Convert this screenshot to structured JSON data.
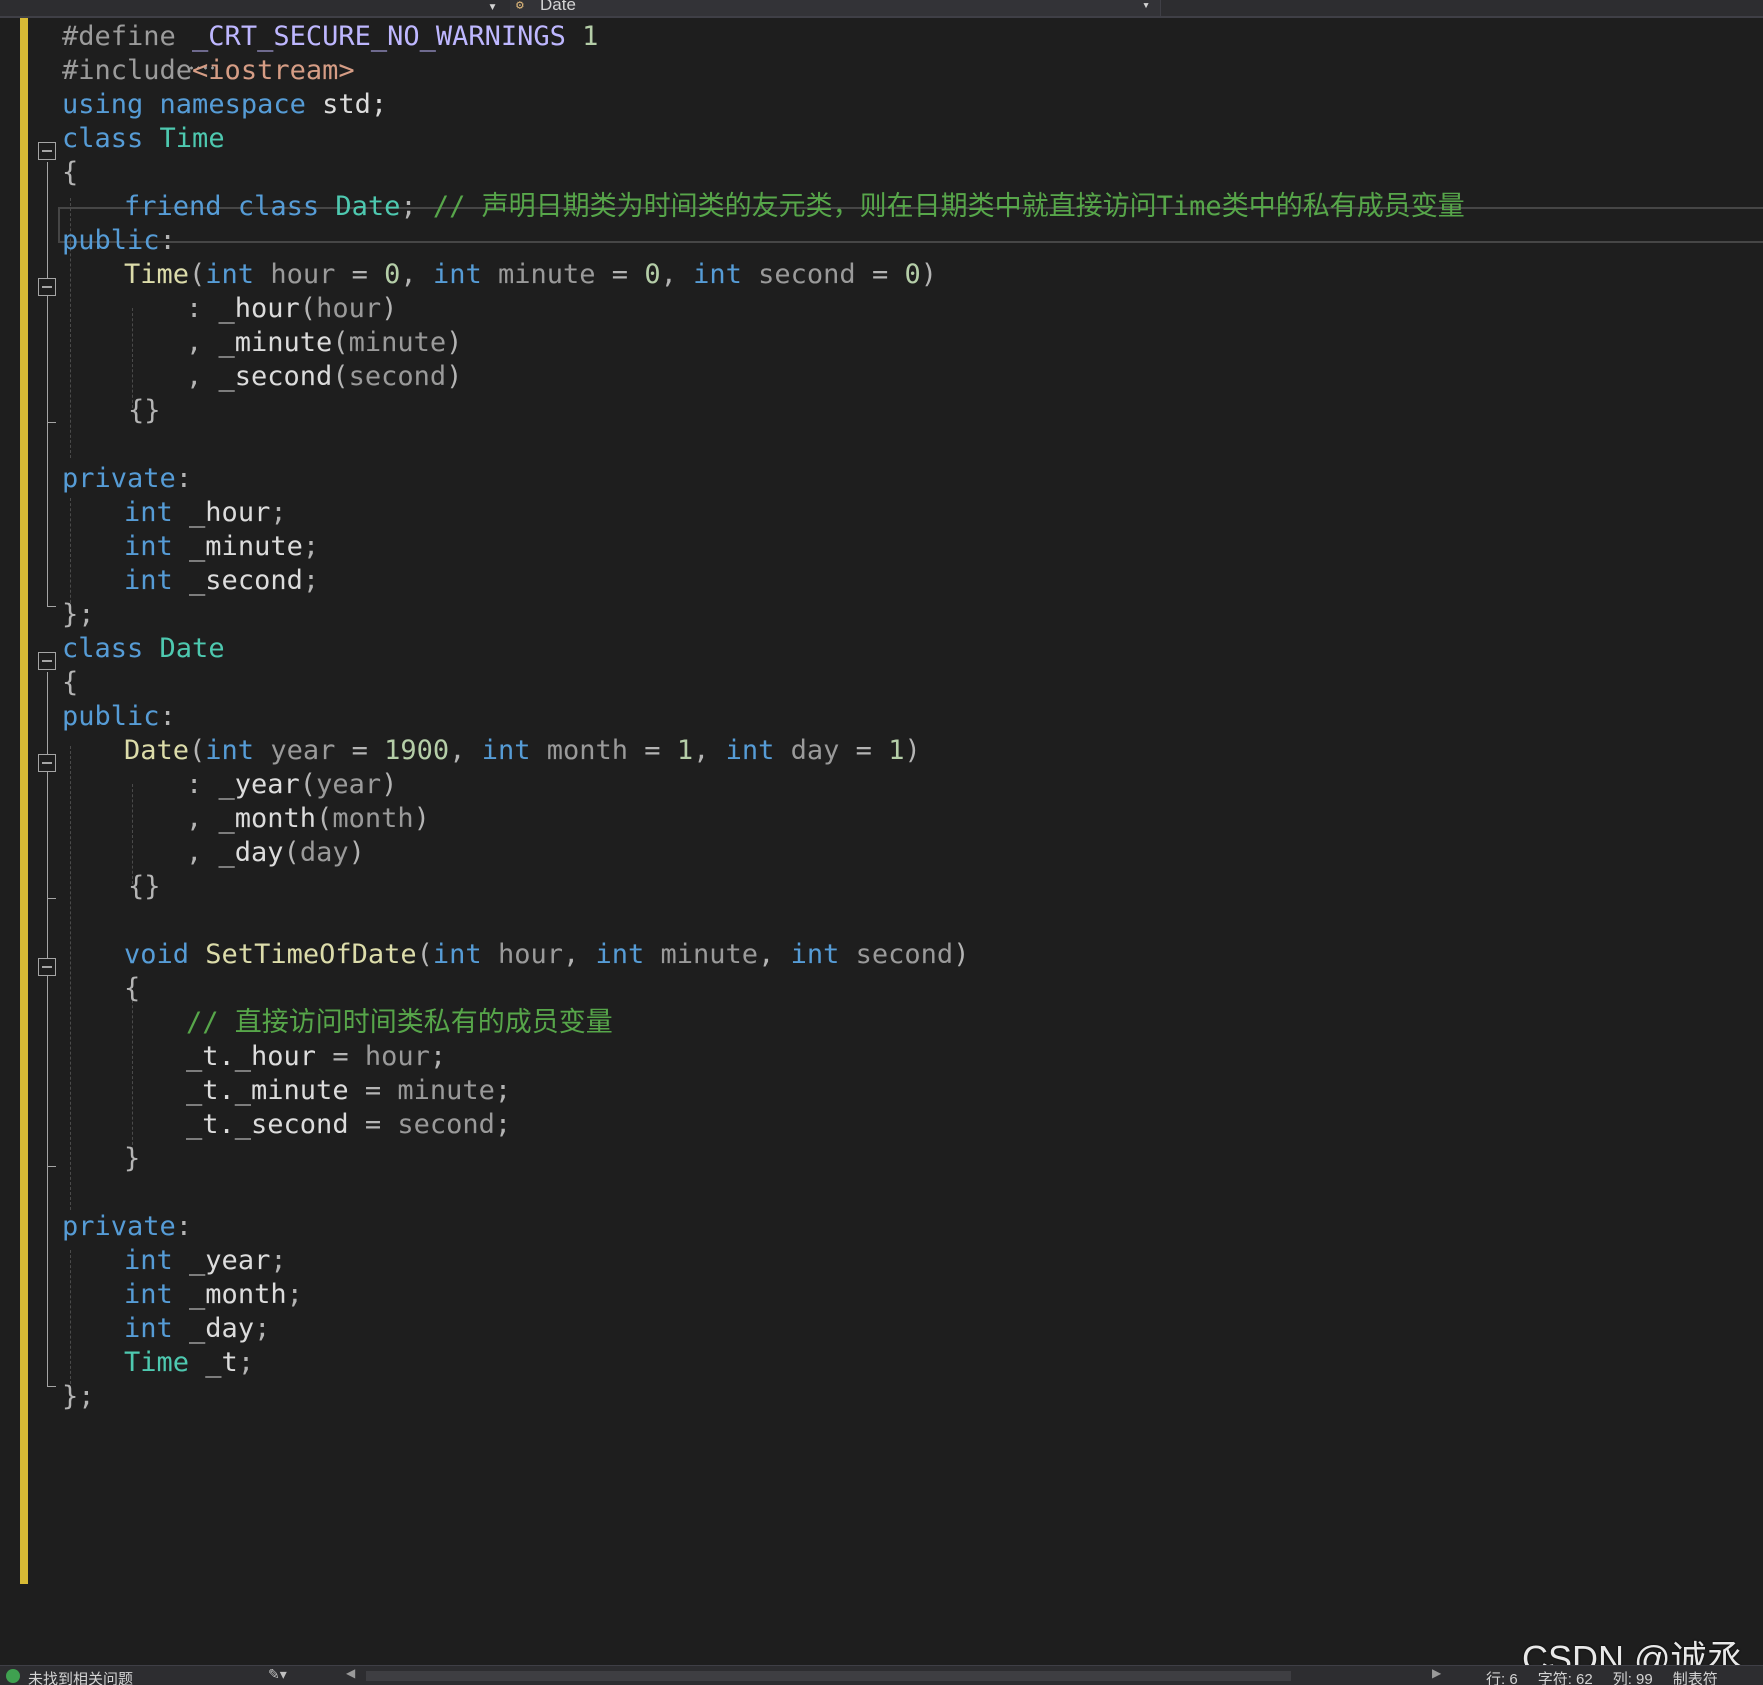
{
  "navbar": {
    "left_dropdown_chevron": "▾",
    "member_icon": "class-icon",
    "member_label": "Date",
    "member_chevron": "▾"
  },
  "code": {
    "l1": [
      "#define ",
      "_CRT_SECURE_NO_WARNINGS",
      " 1"
    ],
    "l2": [
      "#include",
      "<iostream>"
    ],
    "l3": [
      "using",
      " ",
      "namespace",
      " std;"
    ],
    "l4": [
      "class",
      " ",
      "Time"
    ],
    "l5": [
      "{"
    ],
    "l6": [
      "friend",
      " ",
      "class",
      " ",
      "Date",
      "; ",
      "// 声明日期类为时间类的友元类，则在日期类中就直接访问Time类中的私有成员变量"
    ],
    "l7": [
      "public",
      ":"
    ],
    "l8": [
      "Time",
      "(",
      "int",
      " ",
      "hour",
      " = ",
      "0",
      ", ",
      "int",
      " ",
      "minute",
      " = ",
      "0",
      ", ",
      "int",
      " ",
      "second",
      " = ",
      "0",
      ")"
    ],
    "l9": [
      ": ",
      "_hour",
      "(",
      "hour",
      ")"
    ],
    "l10": [
      ", ",
      "_minute",
      "(",
      "minute",
      ")"
    ],
    "l11": [
      ", ",
      "_second",
      "(",
      "second",
      ")"
    ],
    "l12": [
      "{}"
    ],
    "l14": [
      "private",
      ":"
    ],
    "l15": [
      "int",
      " ",
      "_hour",
      ";"
    ],
    "l16": [
      "int",
      " ",
      "_minute",
      ";"
    ],
    "l17": [
      "int",
      " ",
      "_second",
      ";"
    ],
    "l18": [
      "};"
    ],
    "l19": [
      "class",
      " ",
      "Date"
    ],
    "l20": [
      "{"
    ],
    "l21": [
      "public",
      ":"
    ],
    "l22": [
      "Date",
      "(",
      "int",
      " ",
      "year",
      " = ",
      "1900",
      ", ",
      "int",
      " ",
      "month",
      " = ",
      "1",
      ", ",
      "int",
      " ",
      "day",
      " = ",
      "1",
      ")"
    ],
    "l23": [
      ": ",
      "_year",
      "(",
      "year",
      ")"
    ],
    "l24": [
      ", ",
      "_month",
      "(",
      "month",
      ")"
    ],
    "l25": [
      ", ",
      "_day",
      "(",
      "day",
      ")"
    ],
    "l26": [
      "{}"
    ],
    "l28": [
      "void",
      " ",
      "SetTimeOfDate",
      "(",
      "int",
      " ",
      "hour",
      ", ",
      "int",
      " ",
      "minute",
      ", ",
      "int",
      " ",
      "second",
      ")"
    ],
    "l29": [
      "{"
    ],
    "l30": [
      "// 直接访问时间类私有的成员变量"
    ],
    "l31": [
      "_t.",
      "_hour",
      " = ",
      "hour",
      ";"
    ],
    "l32": [
      "_t.",
      "_minute",
      " = ",
      "minute",
      ";"
    ],
    "l33": [
      "_t.",
      "_second",
      " = ",
      "second",
      ";"
    ],
    "l34": [
      "}"
    ],
    "l36": [
      "private",
      ":"
    ],
    "l37": [
      "int",
      " ",
      "_year",
      ";"
    ],
    "l38": [
      "int",
      " ",
      "_month",
      ";"
    ],
    "l39": [
      "int",
      " ",
      "_day",
      ";"
    ],
    "l40": [
      "Time",
      " ",
      "_t",
      ";"
    ],
    "l41": [
      "};"
    ]
  },
  "statusbar": {
    "issues_text": "未找到相关问题",
    "line": "行: 6",
    "char": "字符: 62",
    "col": "列: 99",
    "tabs": "制表符"
  },
  "watermark": "CSDN @诚丞成",
  "colors": {
    "background": "#1e1e1e",
    "keyword": "#569cd6",
    "type": "#4ec9b0",
    "comment": "#57a64a",
    "function": "#dcdcaa",
    "number": "#b5cea8",
    "change_bar": "#d7ba35"
  }
}
